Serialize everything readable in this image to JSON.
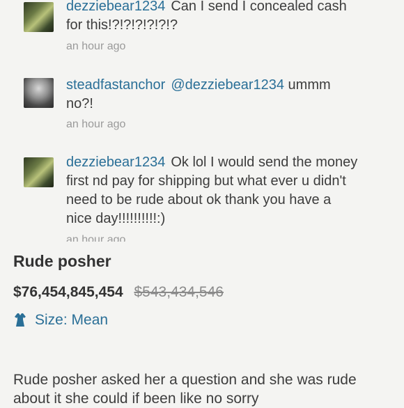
{
  "comments": [
    {
      "username": "dezziebear1234",
      "text": "Can I send I concealed cash for this!?!?!?!?!?!?",
      "time": "an hour ago"
    },
    {
      "username": "steadfastanchor",
      "mention": "@dezziebear1234",
      "text": "ummm no?!",
      "time": "an hour ago"
    },
    {
      "username": "dezziebear1234",
      "text": "Ok lol I would send the money first nd pay for shipping but what ever u didn't need to be rude about ok thank you have a nice day!!!!!!!!!!:)",
      "time": "an hour ago"
    }
  ],
  "listing": {
    "title": "Rude posher",
    "price": "$76,454,845,454",
    "original_price": "$543,434,546",
    "size_label": "Size: Mean",
    "size_icon": "dress-icon",
    "description": "Rude posher asked her a question and she was rude about it she could if been like no sorry"
  },
  "colors": {
    "link": "#2a6f97",
    "background": "#f4f4f2"
  }
}
